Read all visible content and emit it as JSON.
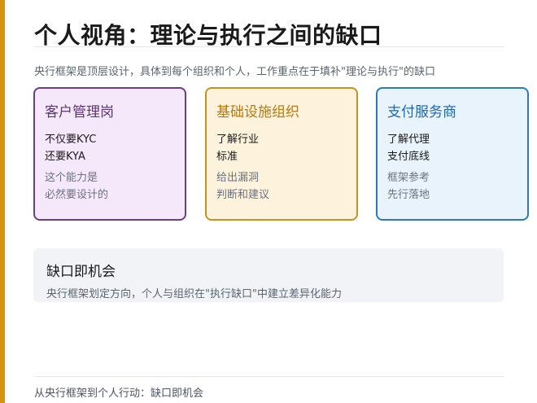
{
  "page": {
    "title": "个人视角：理论与执行之间的缺口",
    "subtitle": "央行框架是顶层设计，具体到每个组织和个人，工作重点在于填补\"理论与执行\"的缺口"
  },
  "colors": {
    "accent_bar": "#d4940f",
    "card_purple": "#6b3f86",
    "card_gold": "#c8921f",
    "card_blue": "#2f78be"
  },
  "cards": [
    {
      "title": "客户管理岗",
      "strong": [
        "不仅要KYC",
        "还要KYA"
      ],
      "muted": [
        "这个能力是",
        "必然要设计的"
      ]
    },
    {
      "title": "基础设施组织",
      "strong": [
        "了解行业",
        "标准"
      ],
      "muted": [
        "给出漏洞",
        "判断和建议"
      ]
    },
    {
      "title": "支付服务商",
      "strong": [
        "了解代理",
        "支付底线"
      ],
      "muted": [
        "框架参考",
        "先行落地"
      ]
    }
  ],
  "callout": {
    "title": "缺口即机会",
    "text": "央行框架划定方向，个人与组织在\"执行缺口\"中建立差异化能力"
  },
  "footer": {
    "text": "从央行框架到个人行动：缺口即机会"
  }
}
